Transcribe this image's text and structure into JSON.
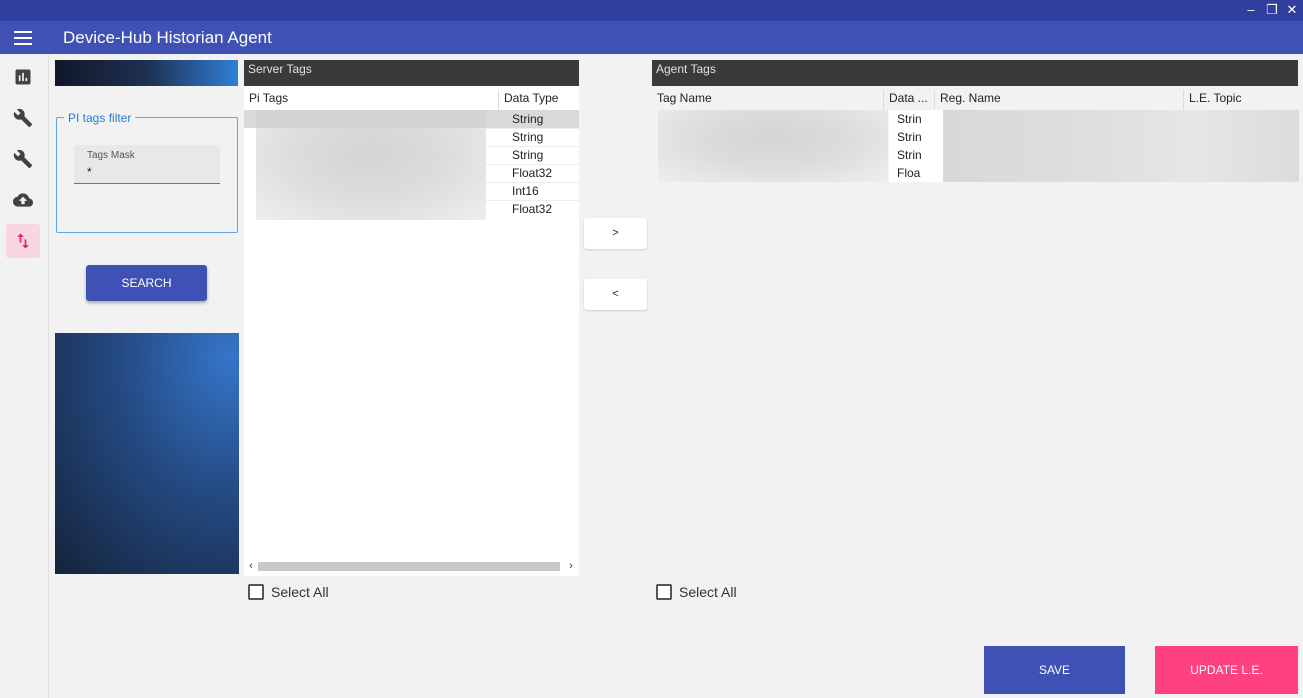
{
  "window": {
    "minimize": "–",
    "restore": "❐",
    "close": "✕"
  },
  "app": {
    "title": "Device-Hub Historian Agent"
  },
  "sidebar": {
    "items": [
      {
        "icon": "bar-chart-icon"
      },
      {
        "icon": "wrench-icon"
      },
      {
        "icon": "wrench-icon"
      },
      {
        "icon": "cloud-upload-icon"
      },
      {
        "icon": "swap-vertical-icon",
        "active": true
      }
    ]
  },
  "filter": {
    "legend": "PI tags filter",
    "mask_label": "Tags Mask",
    "mask_value": "*",
    "search_label": "SEARCH"
  },
  "server_tags": {
    "title": "Server Tags",
    "columns": [
      "Pi Tags",
      "Data Type"
    ],
    "rows": [
      {
        "data_type": "String"
      },
      {
        "data_type": "String"
      },
      {
        "data_type": "String"
      },
      {
        "data_type": "Float32"
      },
      {
        "data_type": "Int16"
      },
      {
        "data_type": "Float32"
      }
    ],
    "scroll_left": "‹",
    "scroll_right": "›",
    "select_all": "Select All"
  },
  "transfer": {
    "add_label": ">",
    "remove_label": "<"
  },
  "agent_tags": {
    "title": "Agent Tags",
    "columns": [
      "Tag Name",
      "Data ...",
      "Reg. Name",
      "L.E. Topic"
    ],
    "rows": [
      {
        "data_type": "Strin"
      },
      {
        "data_type": "Strin"
      },
      {
        "data_type": "Strin"
      },
      {
        "data_type": "Floa"
      }
    ],
    "select_all": "Select All"
  },
  "actions": {
    "save_label": "SAVE",
    "update_label": "UPDATE L.E."
  },
  "colors": {
    "primary": "#3f51b5",
    "primary_dark": "#303f9f",
    "accent": "#ff4081"
  }
}
